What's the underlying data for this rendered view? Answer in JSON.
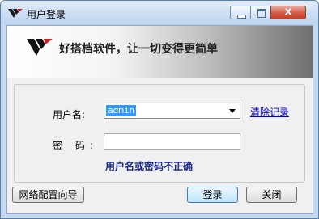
{
  "window": {
    "title": "用户登录",
    "close_symbol": "x"
  },
  "banner": {
    "slogan": "好搭档软件，让一切变得更简单",
    "logo_icon": "yi-logo-icon"
  },
  "form": {
    "username_label": "用户名:",
    "username_value": "admin",
    "clear_link": "清除记录",
    "password_label": "密 码:",
    "password_value": "",
    "error_message": "用户名或密码不正确"
  },
  "buttons": {
    "network_wizard": "网络配置向导",
    "login": "登录",
    "close": "关闭"
  },
  "colors": {
    "title_bar": "#cfe0f4",
    "close_button": "#c5402a",
    "selection": "#3399ff",
    "error_text": "#1a2a8a",
    "link": "#0000cc"
  }
}
